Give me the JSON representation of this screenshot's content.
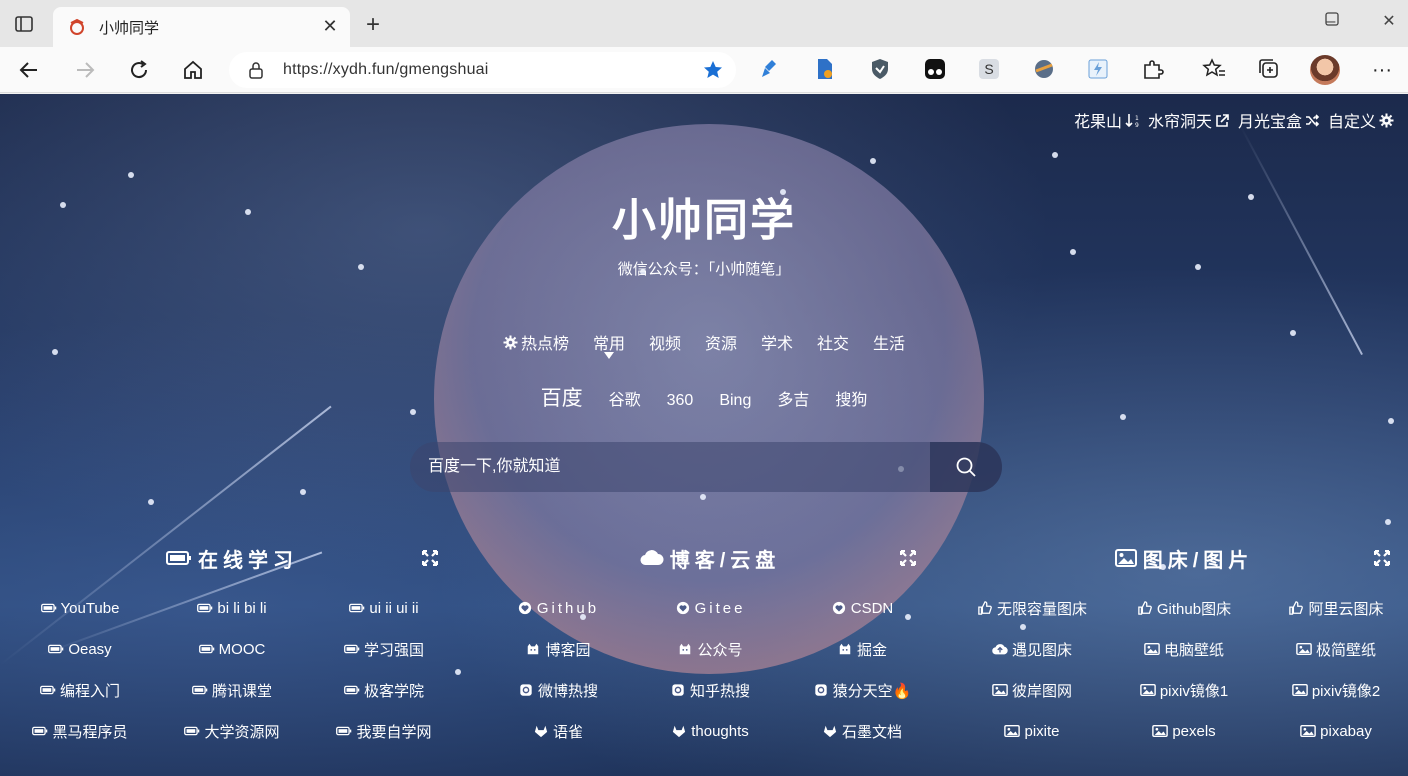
{
  "browser": {
    "tab_title": "小帅同学",
    "url": "https://xydh.fun/gmengshuai"
  },
  "top_links": [
    {
      "label": "花果山",
      "icon": "sort-icon"
    },
    {
      "label": "水帘洞天",
      "icon": "external-link-icon"
    },
    {
      "label": "月光宝盒",
      "icon": "shuffle-icon"
    },
    {
      "label": "自定义",
      "icon": "gear-icon"
    }
  ],
  "site": {
    "title": "小帅同学",
    "subtitle": "微信公众号：「小帅随笔」"
  },
  "categories": {
    "hot": "热点榜",
    "items": [
      "常用",
      "视频",
      "资源",
      "学术",
      "社交",
      "生活"
    ],
    "active": "常用"
  },
  "engines": {
    "current": "百度",
    "items": [
      "谷歌",
      "360",
      "Bing",
      "多吉",
      "搜狗"
    ]
  },
  "search": {
    "placeholder": "百度一下,你就知道"
  },
  "sections": [
    {
      "title": "在线学习",
      "icon": "battery-icon",
      "links": [
        {
          "label": "YouTube",
          "icon": "battery-icon"
        },
        {
          "label": "bi li bi li",
          "icon": "battery-icon"
        },
        {
          "label": "ui ii ui ii",
          "icon": "battery-icon"
        },
        {
          "label": "Oeasy",
          "icon": "battery-icon"
        },
        {
          "label": "MOOC",
          "icon": "battery-icon"
        },
        {
          "label": "学习强国",
          "icon": "battery-icon"
        },
        {
          "label": "编程入门",
          "icon": "battery-icon"
        },
        {
          "label": "腾讯课堂",
          "icon": "battery-icon"
        },
        {
          "label": "极客学院",
          "icon": "battery-icon"
        },
        {
          "label": "黑马程序员",
          "icon": "battery-icon"
        },
        {
          "label": "大学资源网",
          "icon": "battery-icon"
        },
        {
          "label": "我要自学网",
          "icon": "battery-icon"
        }
      ]
    },
    {
      "title": "博客/云盘",
      "icon": "cloud-icon",
      "links": [
        {
          "label": "Github",
          "icon": "heart-icon"
        },
        {
          "label": "Gitee",
          "icon": "heart-icon"
        },
        {
          "label": "CSDN",
          "icon": "heart-icon"
        },
        {
          "label": "博客园",
          "icon": "cat-icon"
        },
        {
          "label": "公众号",
          "icon": "cat-icon"
        },
        {
          "label": "掘金",
          "icon": "cat-icon"
        },
        {
          "label": "微博热搜",
          "icon": "badge-icon"
        },
        {
          "label": "知乎热搜",
          "icon": "badge-icon"
        },
        {
          "label": "猿分天空🔥",
          "icon": "badge-icon"
        },
        {
          "label": "语雀",
          "icon": "gitlab-icon"
        },
        {
          "label": "thoughts",
          "icon": "gitlab-icon"
        },
        {
          "label": "石墨文档",
          "icon": "gitlab-icon"
        }
      ]
    },
    {
      "title": "图床/图片",
      "icon": "image-icon",
      "links": [
        {
          "label": "无限容量图床",
          "icon": "thumbs-up-icon"
        },
        {
          "label": "Github图床",
          "icon": "thumbs-up-icon"
        },
        {
          "label": "阿里云图床",
          "icon": "thumbs-up-icon"
        },
        {
          "label": "遇见图床",
          "icon": "cloud-upload-icon"
        },
        {
          "label": "电脑壁纸",
          "icon": "image-icon"
        },
        {
          "label": "极简壁纸",
          "icon": "image-icon"
        },
        {
          "label": "彼岸图网",
          "icon": "image-icon"
        },
        {
          "label": "pixiv镜像1",
          "icon": "image-icon"
        },
        {
          "label": "pixiv镜像2",
          "icon": "image-icon"
        },
        {
          "label": "pixite",
          "icon": "image-icon"
        },
        {
          "label": "pexels",
          "icon": "image-icon"
        },
        {
          "label": "pixabay",
          "icon": "image-icon"
        }
      ]
    }
  ]
}
